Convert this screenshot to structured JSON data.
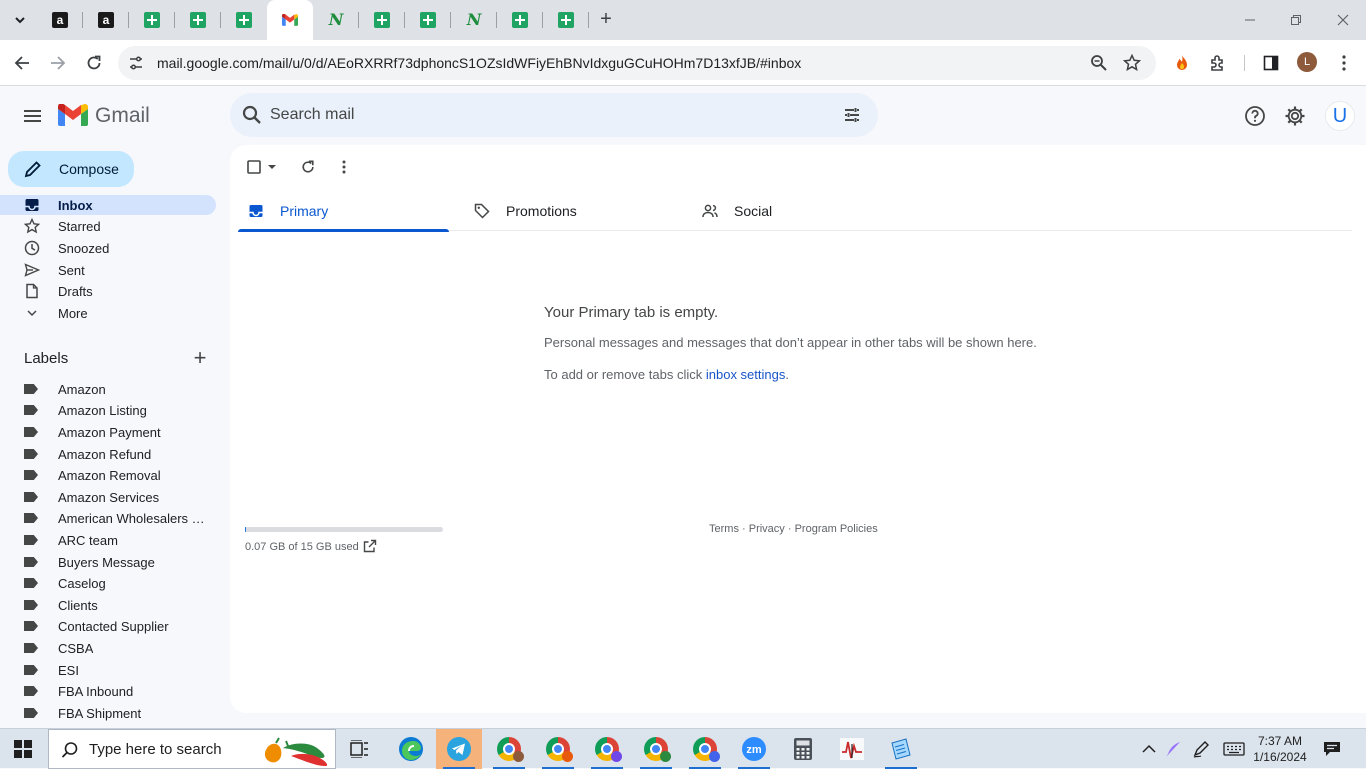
{
  "browser": {
    "tabs": [
      {
        "icon": "amazon-icon"
      },
      {
        "icon": "amazon-icon"
      },
      {
        "icon": "sheets-icon"
      },
      {
        "icon": "sheets-icon"
      },
      {
        "icon": "sheets-icon"
      },
      {
        "icon": "gmail-icon",
        "active": true
      },
      {
        "icon": "n-logo-icon"
      },
      {
        "icon": "sheets-icon"
      },
      {
        "icon": "sheets-icon"
      },
      {
        "icon": "n-logo-icon"
      },
      {
        "icon": "sheets-icon"
      },
      {
        "icon": "sheets-icon"
      }
    ],
    "new_tab_label": "+",
    "url": "mail.google.com/mail/u/0/d/AEoRXRRf73dphoncS1OZsIdWFiyEhBNvIdxguGCuHOHm7D13xfJB/#inbox",
    "profile_initial": "L"
  },
  "gmail": {
    "logo_text": "Gmail",
    "search": {
      "placeholder": "Search mail"
    },
    "account_initial": "U",
    "compose_label": "Compose",
    "nav": [
      {
        "label": "Inbox",
        "icon": "inbox-icon",
        "active": true
      },
      {
        "label": "Starred",
        "icon": "star-icon"
      },
      {
        "label": "Snoozed",
        "icon": "clock-icon"
      },
      {
        "label": "Sent",
        "icon": "send-icon"
      },
      {
        "label": "Drafts",
        "icon": "draft-icon"
      },
      {
        "label": "More",
        "icon": "chevron-down-icon"
      }
    ],
    "labels_heading": "Labels",
    "labels": [
      "Amazon",
      "Amazon Listing",
      "Amazon Payment",
      "Amazon Refund",
      "Amazon Removal",
      "Amazon Services",
      "American Wholesalers L...",
      "ARC team",
      "Buyers Message",
      "Caselog",
      "Clients",
      "Contacted Supplier",
      "CSBA",
      "ESI",
      "FBA Inbound",
      "FBA Shipment"
    ],
    "category_tabs": [
      {
        "label": "Primary",
        "icon": "inbox-icon",
        "active": true
      },
      {
        "label": "Promotions",
        "icon": "tag-icon"
      },
      {
        "label": "Social",
        "icon": "people-icon"
      }
    ],
    "empty_state": {
      "title": "Your Primary tab is empty.",
      "description": "Personal messages and messages that don’t appear in other tabs will be shown here.",
      "settings_prefix": "To add or remove tabs click ",
      "settings_link": "inbox settings",
      "settings_suffix": "."
    },
    "storage": {
      "text": "0.07 GB of 15 GB used",
      "used_fraction": 0.005
    },
    "footer": {
      "terms": "Terms",
      "sep": " · ",
      "privacy": "Privacy",
      "policies": "Program Policies"
    }
  },
  "taskbar": {
    "search_placeholder": "Type here to search",
    "clock_time": "7:37 AM",
    "clock_date": "1/16/2024",
    "accent_active": "#f5b27a"
  }
}
